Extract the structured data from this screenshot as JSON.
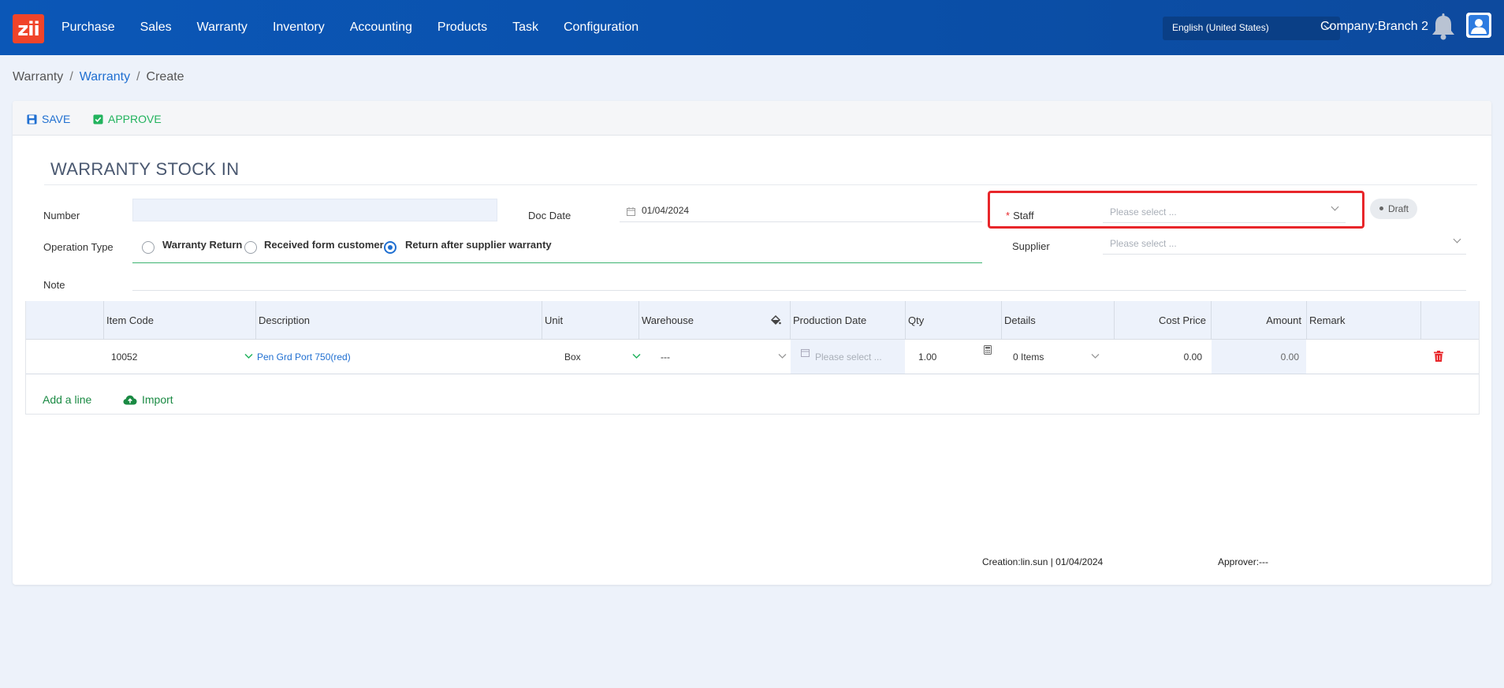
{
  "app": {
    "logo_text": "zii",
    "nav": [
      "Purchase",
      "Sales",
      "Warranty",
      "Inventory",
      "Accounting",
      "Products",
      "Task",
      "Configuration"
    ],
    "language": "English (United States)",
    "company": "Company:Branch 2",
    "icons": {
      "bell": "bell-icon",
      "user": "user-icon"
    },
    "colors": {
      "topbar": "#0b57b7",
      "logo": "#f0442a",
      "accent": "#1f6fd1",
      "success": "#22b35e",
      "danger": "#e8262a"
    }
  },
  "breadcrumb": {
    "root": "Warranty",
    "link": "Warranty",
    "current": "Create",
    "separator": "/"
  },
  "toolbar": {
    "save_label": "SAVE",
    "approve_label": "APPROVE"
  },
  "form": {
    "title": "WARRANTY STOCK IN",
    "number_label": "Number",
    "number_value": "",
    "doc_date_label": "Doc Date",
    "doc_date_value": "01/04/2024",
    "staff_label": "Staff",
    "staff_required_mark": "*",
    "staff_placeholder": "Please select ...",
    "status": "Draft",
    "operation_type_label": "Operation Type",
    "operation_options": [
      "Warranty Return",
      "Received form customer",
      "Return after supplier warranty"
    ],
    "operation_selected": "Return after supplier warranty",
    "supplier_label": "Supplier",
    "supplier_placeholder": "Please select ...",
    "note_label": "Note",
    "note_value": ""
  },
  "table": {
    "headers": [
      "Item Code",
      "Description",
      "Unit",
      "Warehouse",
      "Production Date",
      "Qty",
      "Details",
      "Cost Price",
      "Amount",
      "Remark"
    ],
    "rows": [
      {
        "item_code": "10052",
        "description": "Pen Grd Port 750(red)",
        "unit": "Box",
        "warehouse": "---",
        "production_date_placeholder": "Please select ...",
        "qty": "1.00",
        "details": "0 Items",
        "cost_price": "0.00",
        "amount": "0.00",
        "remark": ""
      }
    ],
    "add_line_label": "Add a line",
    "import_label": "Import"
  },
  "footer": {
    "creation": "Creation:lin.sun | 01/04/2024",
    "approver": "Approver:---"
  }
}
